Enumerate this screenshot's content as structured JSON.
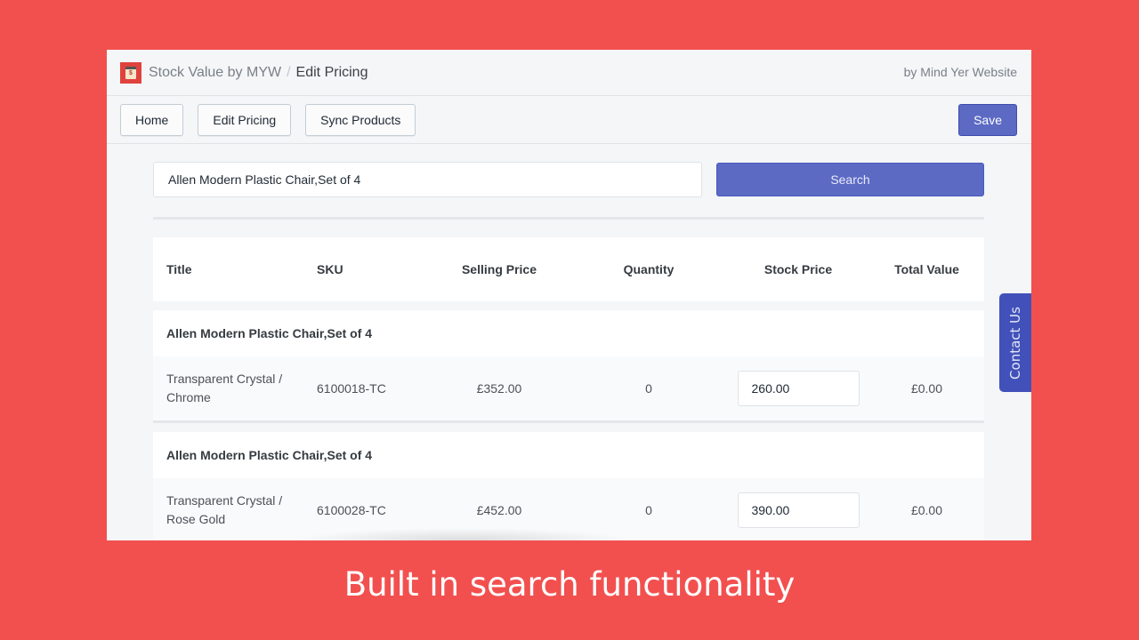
{
  "header": {
    "app_name": "Stock Value by MYW",
    "separator": "/",
    "current_page": "Edit Pricing",
    "byline": "by Mind Yer Website",
    "logo_icon": "clipboard-dollar-icon"
  },
  "nav": {
    "buttons": [
      "Home",
      "Edit Pricing",
      "Sync Products"
    ],
    "save_label": "Save"
  },
  "search": {
    "value": "Allen Modern Plastic Chair,Set of 4",
    "button_label": "Search"
  },
  "table": {
    "columns": [
      "Title",
      "SKU",
      "Selling Price",
      "Quantity",
      "Stock Price",
      "Total Value"
    ],
    "groups": [
      {
        "title": "Allen Modern Plastic Chair,Set of 4",
        "variants": [
          {
            "variant": "Transparent Crystal / Chrome",
            "sku": "6100018-TC",
            "selling_price": "£352.00",
            "quantity": "0",
            "stock_price": "260.00",
            "total_value": "£0.00"
          }
        ]
      },
      {
        "title": "Allen Modern Plastic Chair,Set of 4",
        "variants": [
          {
            "variant": "Transparent Crystal / Rose Gold",
            "sku": "6100028-TC",
            "selling_price": "£452.00",
            "quantity": "0",
            "stock_price": "390.00",
            "total_value": "£0.00"
          }
        ]
      }
    ]
  },
  "contact_tab": "Contact Us",
  "caption": "Built in search functionality",
  "colors": {
    "background": "#f2504f",
    "primary": "#5c6ac4",
    "contact_tab": "#4151b9"
  }
}
